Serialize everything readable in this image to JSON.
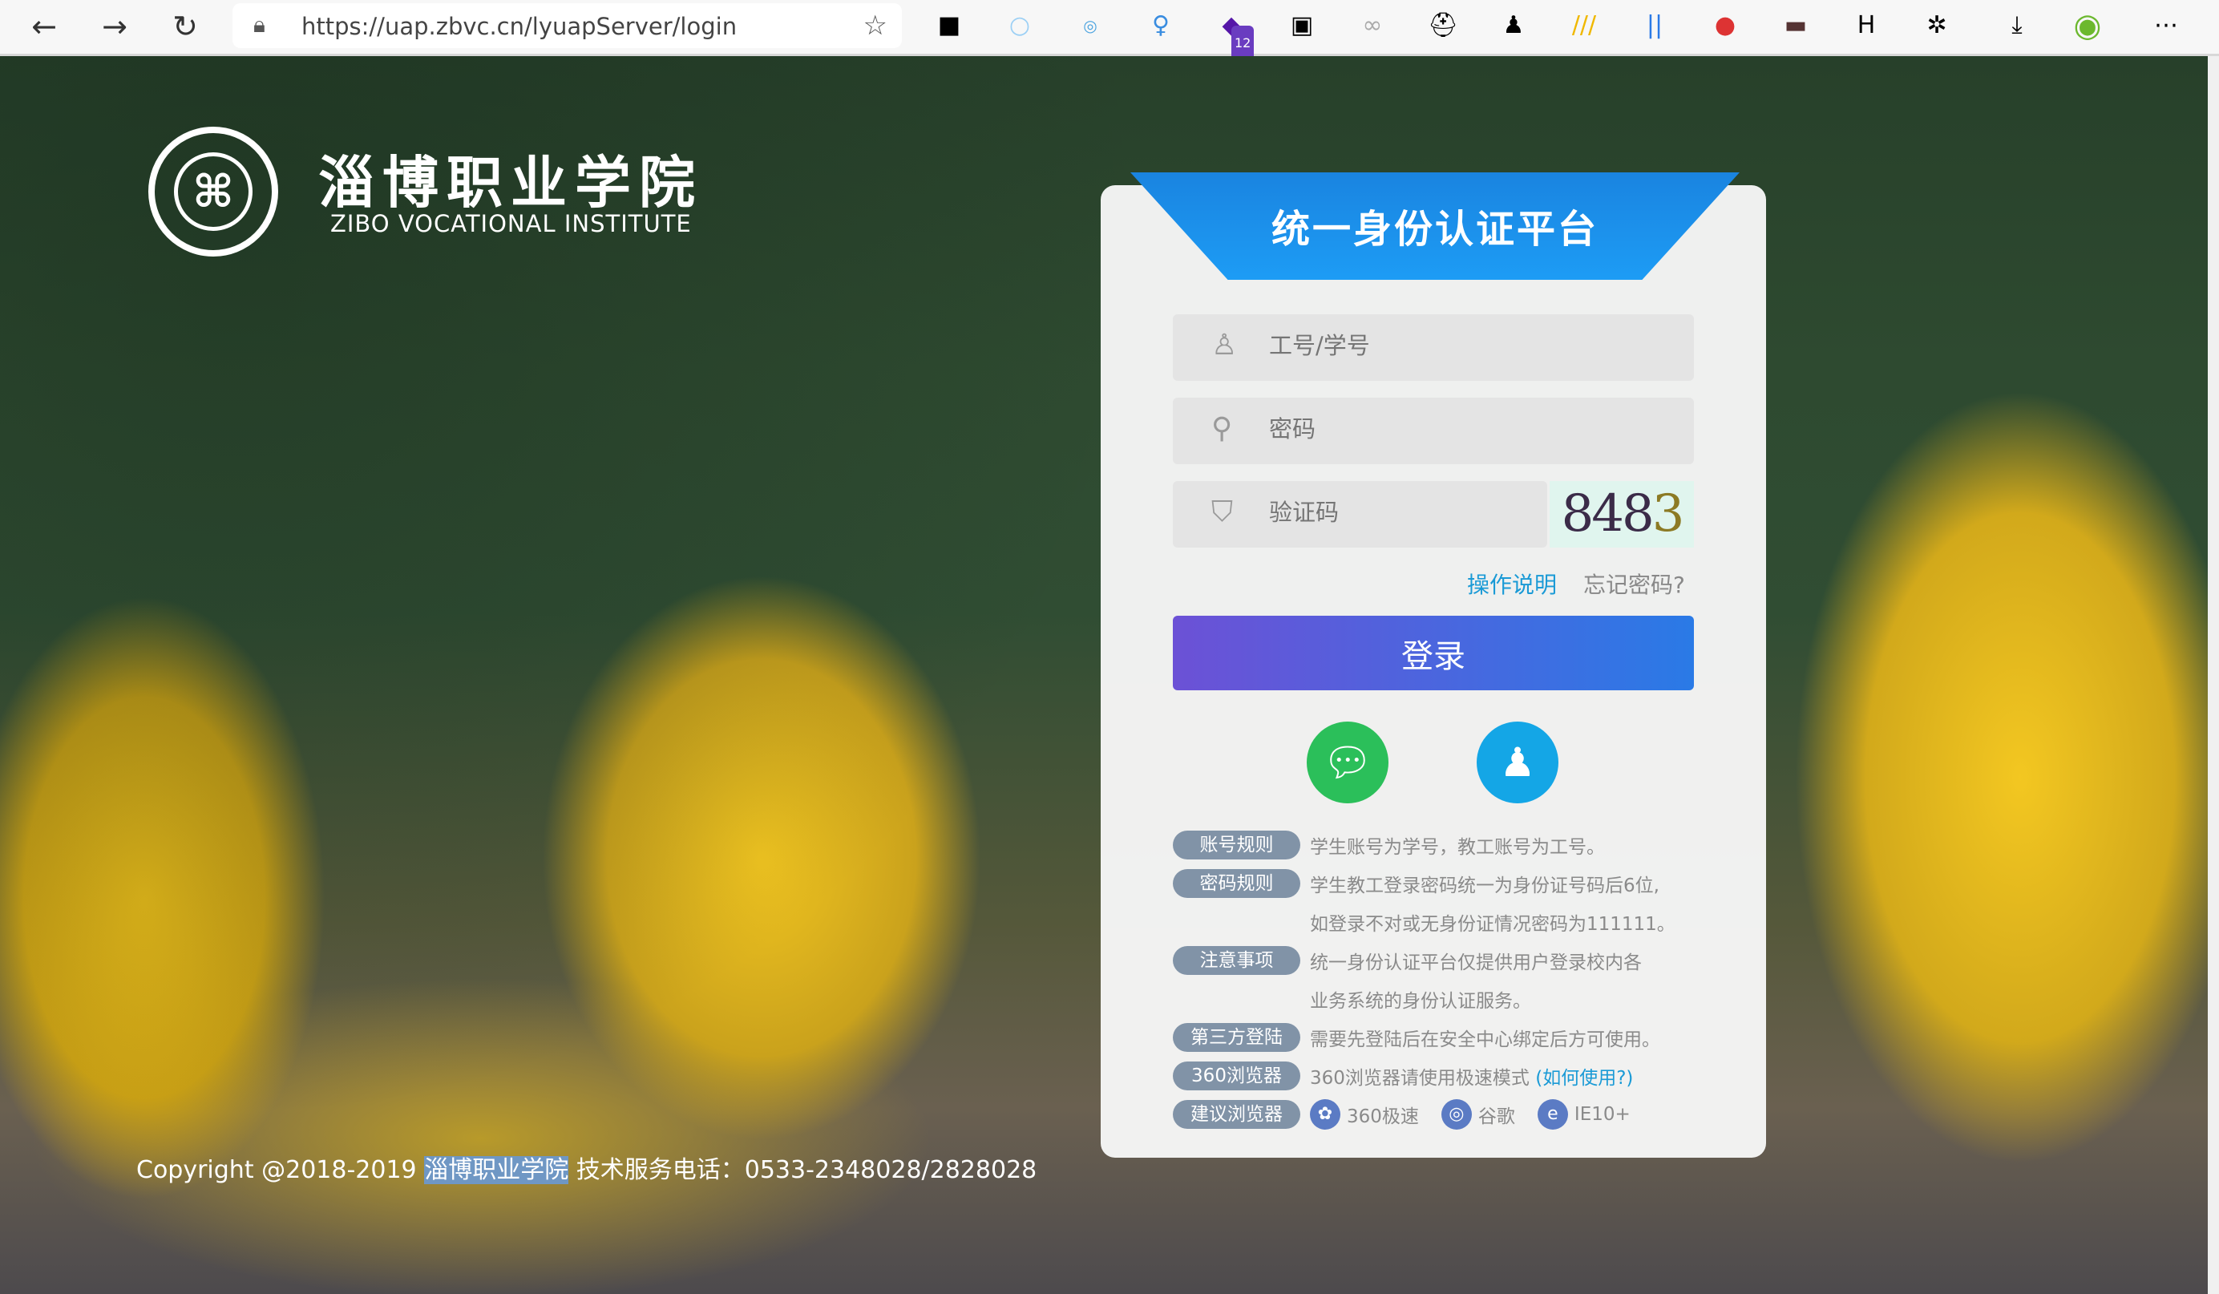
{
  "browser": {
    "url": "https://uap.zbvc.cn/lyuapServer/login",
    "extension_badge": "12",
    "icons": [
      "back-icon",
      "forward-icon",
      "reload-icon",
      "lock-icon",
      "add-favorite-icon"
    ]
  },
  "school": {
    "name_cn": "淄博职业学院",
    "name_en": "ZIBO VOCATIONAL INSTITUTE"
  },
  "login": {
    "title": "统一身份认证平台",
    "username_placeholder": "工号/学号",
    "password_placeholder": "密码",
    "captcha_placeholder": "验证码",
    "captcha_code": [
      "848",
      "3"
    ],
    "help_link": "操作说明",
    "forgot_link": "忘记密码?",
    "submit": "登录"
  },
  "info": [
    {
      "tag": "账号规则",
      "text": "学生账号为学号，教工账号为工号。"
    },
    {
      "tag": "密码规则",
      "text": "学生教工登录密码统一为身份证号码后6位,"
    },
    {
      "tag": "",
      "text": "如登录不对或无身份证情况密码为111111。"
    },
    {
      "tag": "注意事项",
      "text": "统一身份认证平台仅提供用户登录校内各"
    },
    {
      "tag": "",
      "text": "业务系统的身份认证服务。"
    },
    {
      "tag": "第三方登陆",
      "text": "需要先登陆后在安全中心绑定后方可使用。"
    },
    {
      "tag": "360浏览器",
      "text": "360浏览器请使用极速模式",
      "link": "(如何使用?)"
    },
    {
      "tag": "建议浏览器",
      "browsers": [
        "360极速",
        "谷歌",
        "IE10+"
      ]
    }
  ],
  "footer": {
    "prefix": "Copyright @2018-2019",
    "school": "淄博职业学院",
    "suffix": "技术服务电话：0533-2348028/2828028"
  },
  "colors": {
    "brand_blue": "#1d9cf5",
    "button_start": "#6c51d6",
    "button_end": "#2a7ae6",
    "tag": "#8193a7"
  }
}
